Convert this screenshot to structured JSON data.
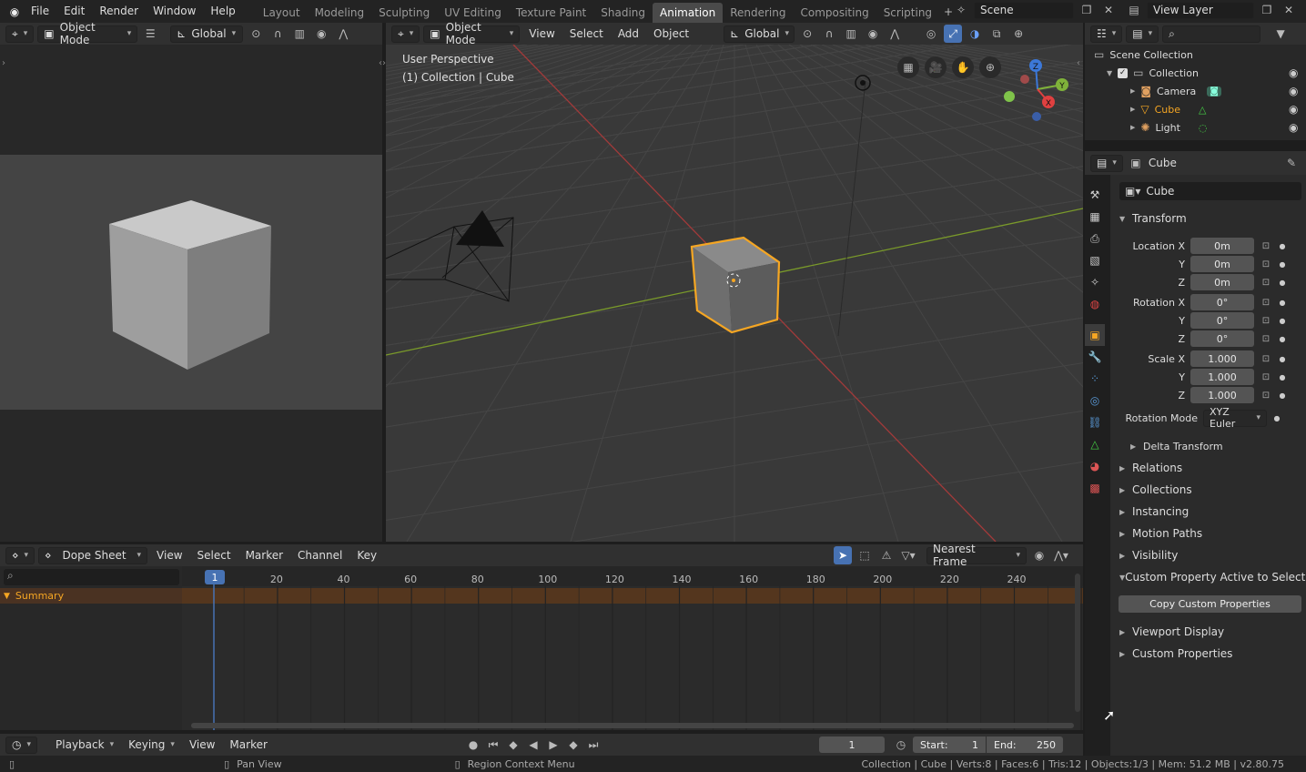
{
  "topbar": {
    "menus": [
      "File",
      "Edit",
      "Render",
      "Window",
      "Help"
    ],
    "workspaces": [
      "Layout",
      "Modeling",
      "Sculpting",
      "UV Editing",
      "Texture Paint",
      "Shading",
      "Animation",
      "Rendering",
      "Compositing",
      "Scripting"
    ],
    "active_workspace": "Animation",
    "scene": "Scene",
    "view_layer": "View Layer"
  },
  "camview": {
    "mode": "Object Mode",
    "orientation": "Global"
  },
  "viewport": {
    "mode": "Object Mode",
    "menus": [
      "View",
      "Select",
      "Add",
      "Object"
    ],
    "orientation": "Global",
    "overlay_title": "User Perspective",
    "overlay_sub": "(1) Collection | Cube",
    "gizmo_axes": [
      "Z",
      "Y",
      "X"
    ]
  },
  "outliner": {
    "root": "Scene Collection",
    "collection": "Collection",
    "items": [
      {
        "name": "Camera",
        "icon": "camera-icon",
        "color": "#dddddd"
      },
      {
        "name": "Cube",
        "icon": "mesh-icon",
        "color": "#f5a623"
      },
      {
        "name": "Light",
        "icon": "light-icon",
        "color": "#dddddd"
      }
    ]
  },
  "properties": {
    "header_object": "Cube",
    "name_field": "Cube",
    "transform_title": "Transform",
    "location": {
      "label_x": "Location X",
      "label_y": "Y",
      "label_z": "Z",
      "x": "0m",
      "y": "0m",
      "z": "0m"
    },
    "rotation": {
      "label_x": "Rotation X",
      "label_y": "Y",
      "label_z": "Z",
      "x": "0°",
      "y": "0°",
      "z": "0°"
    },
    "scale": {
      "label_x": "Scale X",
      "label_y": "Y",
      "label_z": "Z",
      "x": "1.000",
      "y": "1.000",
      "z": "1.000"
    },
    "rotation_mode_label": "Rotation Mode",
    "rotation_mode": "XYZ Euler",
    "delta": "Delta Transform",
    "sections": [
      "Relations",
      "Collections",
      "Instancing",
      "Motion Paths",
      "Visibility"
    ],
    "custom_active": "Custom Property Active to Selected",
    "copy_button": "Copy Custom Properties",
    "sections_after": [
      "Viewport Display",
      "Custom Properties"
    ]
  },
  "dopesheet": {
    "editor": "Dope Sheet",
    "menus": [
      "View",
      "Select",
      "Marker",
      "Channel",
      "Key"
    ],
    "snap": "Nearest Frame",
    "summary": "Summary",
    "current_frame": "1",
    "ticks": [
      "20",
      "40",
      "60",
      "80",
      "100",
      "120",
      "140",
      "160",
      "180",
      "200",
      "220",
      "240"
    ]
  },
  "timeline": {
    "playback": "Playback",
    "keying": "Keying",
    "menus": [
      "View",
      "Marker"
    ],
    "frame": "1",
    "start_label": "Start:",
    "start": "1",
    "end_label": "End:",
    "end": "250"
  },
  "statusbar": {
    "pan": "Pan View",
    "context": "Region Context Menu",
    "stats": "Collection | Cube | Verts:8 | Faces:6 | Tris:12 | Objects:1/3 | Mem: 51.2 MB | v2.80.75"
  },
  "colors": {
    "accent": "#f5a623",
    "active_tab": "#4a4a4a",
    "select_blue": "#4772b3"
  }
}
